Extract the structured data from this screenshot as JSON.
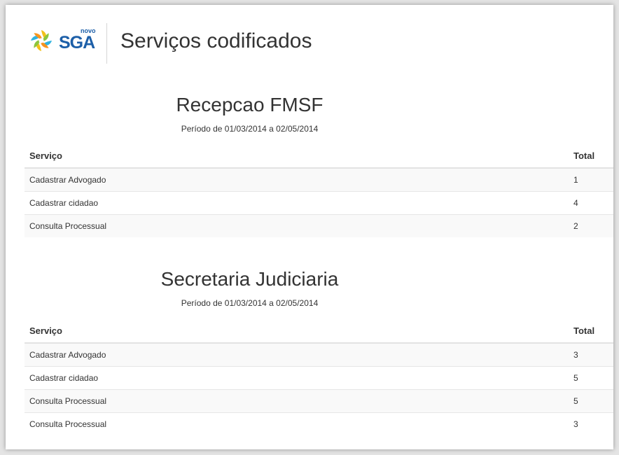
{
  "header": {
    "logo_small_text": "novo",
    "logo_text": "SGA",
    "page_title": "Serviços codificados"
  },
  "reports": [
    {
      "title": "Recepcao FMSF",
      "period": "Período de 01/03/2014 a 02/05/2014",
      "columns": [
        "Serviço",
        "Total"
      ],
      "rows": [
        {
          "servico": "Cadastrar Advogado",
          "total": "1"
        },
        {
          "servico": "Cadastrar cidadao",
          "total": "4"
        },
        {
          "servico": "Consulta Processual",
          "total": "2"
        }
      ]
    },
    {
      "title": "Secretaria Judiciaria",
      "period": "Período de 01/03/2014 a 02/05/2014",
      "columns": [
        "Serviço",
        "Total"
      ],
      "rows": [
        {
          "servico": "Cadastrar Advogado",
          "total": "3"
        },
        {
          "servico": "Cadastrar cidadao",
          "total": "5"
        },
        {
          "servico": "Consulta Processual",
          "total": "5"
        },
        {
          "servico": "Consulta Processual",
          "total": "3"
        }
      ]
    }
  ],
  "colors": {
    "logo_blue": "#1d5fa8",
    "logo_yellow": "#f2c21a",
    "logo_cyan": "#2fb3df"
  }
}
